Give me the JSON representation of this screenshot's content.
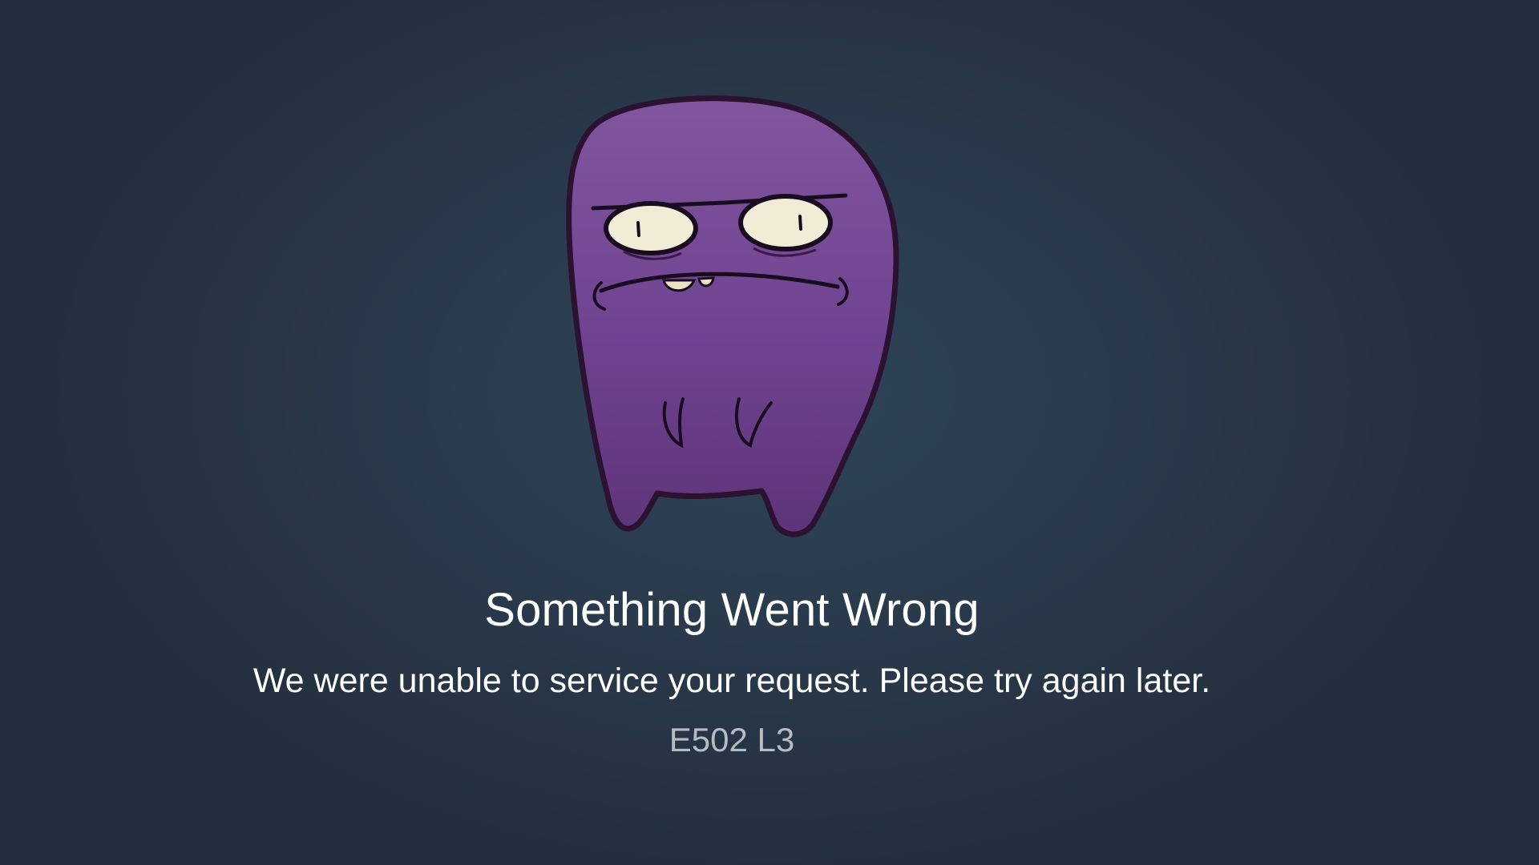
{
  "error": {
    "title": "Something Went Wrong",
    "message": "We were unable to service your request. Please try again later.",
    "code": "E502 L3"
  },
  "mascot": {
    "icon": "purple-blob-mascot-icon",
    "body_color": "#7a4a98",
    "outline_color": "#2a1230",
    "eye_color": "#f1ecd6"
  },
  "colors": {
    "background": "#29394b",
    "title_text": "#ffffff",
    "message_text": "#ffffff",
    "code_text": "#b7bcc3"
  }
}
